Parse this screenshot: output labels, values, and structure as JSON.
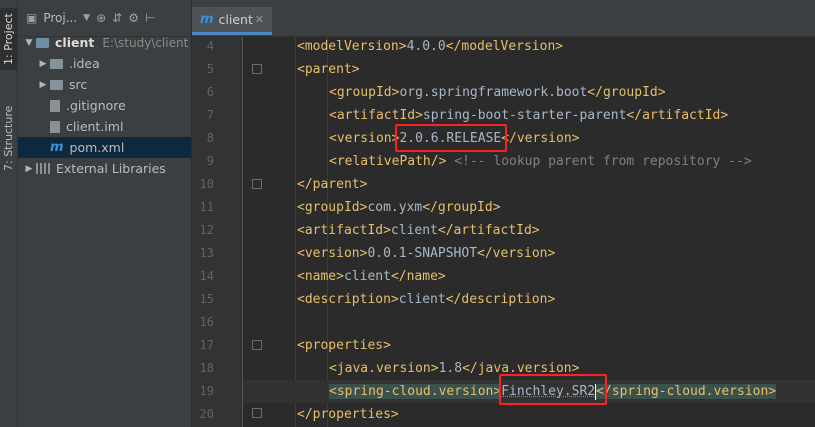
{
  "sidebar_tabs": {
    "project": "1: Project",
    "structure": "7: Structure"
  },
  "project_panel": {
    "title": "Proj...",
    "icons": [
      "globe-icon",
      "collapse-icon",
      "gear-icon",
      "hide-icon"
    ],
    "tree": [
      {
        "label": "client",
        "path": "E:\\study\\client",
        "type": "module",
        "expanded": true
      },
      {
        "label": ".idea",
        "type": "folder"
      },
      {
        "label": "src",
        "type": "folder"
      },
      {
        "label": ".gitignore",
        "type": "file"
      },
      {
        "label": "client.iml",
        "type": "file"
      },
      {
        "label": "pom.xml",
        "type": "maven",
        "selected": true
      },
      {
        "label": "External Libraries",
        "type": "libraries"
      }
    ]
  },
  "editor": {
    "tab_label": "client",
    "line_numbers": [
      "4",
      "5",
      "6",
      "7",
      "8",
      "9",
      "10",
      "11",
      "12",
      "13",
      "14",
      "15",
      "16",
      "17",
      "18",
      "19",
      "20"
    ],
    "lines": {
      "l4": {
        "open": "<modelVersion>",
        "text": "4.0.0",
        "close": "</modelVersion>"
      },
      "l5": {
        "open": "<parent>"
      },
      "l6": {
        "open": "<groupId>",
        "text": "org.springframework.boot",
        "close": "</groupId>"
      },
      "l7": {
        "open": "<artifactId>",
        "text": "spring-boot-starter-parent",
        "close": "</artifactId>"
      },
      "l8": {
        "open": "<version>",
        "text": "2.0.6.RELEASE",
        "close": "</version>"
      },
      "l9": {
        "open": "<relativePath/>",
        "comment": "<!-- lookup parent from repository -->"
      },
      "l10": {
        "close": "</parent>"
      },
      "l11": {
        "open": "<groupId>",
        "text": "com.yxm",
        "close": "</groupId>"
      },
      "l12": {
        "open": "<artifactId>",
        "text": "client",
        "close": "</artifactId>"
      },
      "l13": {
        "open": "<version>",
        "text": "0.0.1-SNAPSHOT",
        "close": "</version>"
      },
      "l14": {
        "open": "<name>",
        "text": "client",
        "close": "</name>"
      },
      "l15": {
        "open": "<description>",
        "text": "client",
        "close": "</description>"
      },
      "l17": {
        "open": "<properties>"
      },
      "l18": {
        "open": "<java.version>",
        "text": "1.8",
        "close": "</java.version>"
      },
      "l19": {
        "open": "<spring-cloud.version>",
        "text": "Finchley.SR2",
        "close": "</spring-cloud.version>"
      },
      "l20": {
        "close": "</properties>"
      }
    }
  },
  "colors": {
    "tag": "#e8bf6a",
    "text": "#a9b7c6",
    "comment": "#808080",
    "highlight_box": "#ff2020"
  }
}
